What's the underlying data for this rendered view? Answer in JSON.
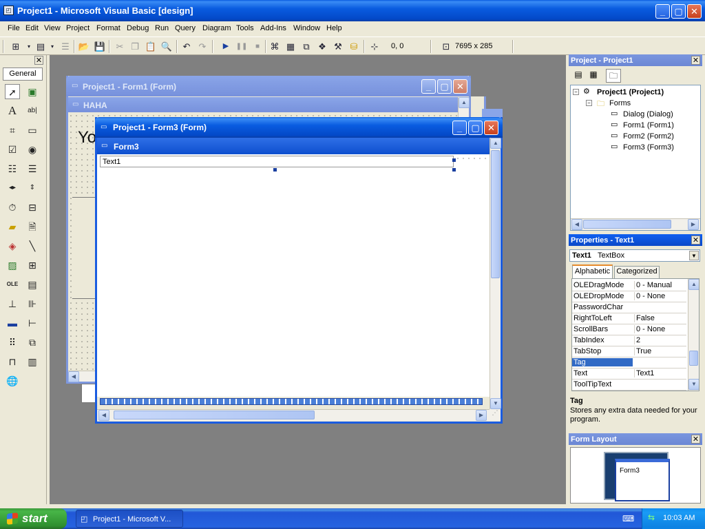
{
  "window": {
    "title": "Project1 - Microsoft Visual Basic [design]"
  },
  "menu": [
    "File",
    "Edit",
    "View",
    "Project",
    "Format",
    "Debug",
    "Run",
    "Query",
    "Diagram",
    "Tools",
    "Add-Ins",
    "Window",
    "Help"
  ],
  "toolbar": {
    "position": "0, 0",
    "size": "7695 x 285"
  },
  "toolbox": {
    "tab_label": "General"
  },
  "forms": {
    "form1": {
      "title": "Project1 - Form1 (Form)",
      "caption": "HAHA",
      "label_fragment": "Yo"
    },
    "form3": {
      "title": "Project1 - Form3 (Form)",
      "caption": "Form3",
      "textbox_value": "Text1"
    }
  },
  "project_panel": {
    "title": "Project - Project1",
    "root": "Project1 (Project1)",
    "folder": "Forms",
    "items": [
      "Dialog (Dialog)",
      "Form1 (Form1)",
      "Form2 (Form2)",
      "Form3 (Form3)"
    ]
  },
  "properties_panel": {
    "title": "Properties - Text1",
    "object_name": "Text1",
    "object_type": "TextBox",
    "tabs": [
      "Alphabetic",
      "Categorized"
    ],
    "rows": [
      {
        "name": "OLEDragMode",
        "value": "0 - Manual"
      },
      {
        "name": "OLEDropMode",
        "value": "0 - None"
      },
      {
        "name": "PasswordChar",
        "value": ""
      },
      {
        "name": "RightToLeft",
        "value": "False"
      },
      {
        "name": "ScrollBars",
        "value": "0 - None"
      },
      {
        "name": "TabIndex",
        "value": "2"
      },
      {
        "name": "TabStop",
        "value": "True"
      },
      {
        "name": "Tag",
        "value": ""
      },
      {
        "name": "Text",
        "value": "Text1"
      },
      {
        "name": "ToolTipText",
        "value": ""
      }
    ],
    "selected_row": "Tag",
    "description_title": "Tag",
    "description_text": "Stores any extra data needed for your program."
  },
  "form_layout": {
    "title": "Form Layout",
    "form_label": "Form3"
  },
  "taskbar": {
    "start_label": "start",
    "task_label": "Project1 - Microsoft V...",
    "clock": "10:03 AM"
  },
  "colors": {
    "titlebar": "#0a5ce0",
    "selection": "#316ac5",
    "mdi_background": "#808080"
  }
}
